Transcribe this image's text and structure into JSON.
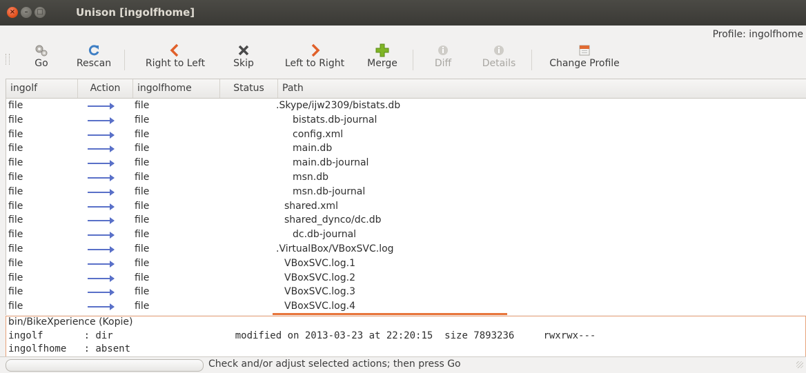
{
  "window": {
    "title": "Unison [ingolfhome]"
  },
  "profile_label": "Profile: ingolfhome",
  "toolbar": {
    "go": "Go",
    "rescan": "Rescan",
    "right_to_left": "Right to Left",
    "skip": "Skip",
    "left_to_right": "Left to Right",
    "merge": "Merge",
    "diff": "Diff",
    "details": "Details",
    "change_profile": "Change Profile"
  },
  "columns": [
    "ingolf",
    "Action",
    "ingolfhome",
    "Status",
    "Path"
  ],
  "rows": [
    {
      "left": "file",
      "right": "file",
      "path": ".Skype/ijw2309/bistats.db",
      "indent": 0
    },
    {
      "left": "file",
      "right": "file",
      "path": "bistats.db-journal",
      "indent": 2
    },
    {
      "left": "file",
      "right": "file",
      "path": "config.xml",
      "indent": 2
    },
    {
      "left": "file",
      "right": "file",
      "path": "main.db",
      "indent": 2
    },
    {
      "left": "file",
      "right": "file",
      "path": "main.db-journal",
      "indent": 2
    },
    {
      "left": "file",
      "right": "file",
      "path": "msn.db",
      "indent": 2
    },
    {
      "left": "file",
      "right": "file",
      "path": "msn.db-journal",
      "indent": 2
    },
    {
      "left": "file",
      "right": "file",
      "path": "shared.xml",
      "indent": 1
    },
    {
      "left": "file",
      "right": "file",
      "path": "shared_dynco/dc.db",
      "indent": 1
    },
    {
      "left": "file",
      "right": "file",
      "path": "dc.db-journal",
      "indent": 2
    },
    {
      "left": "file",
      "right": "file",
      "path": ".VirtualBox/VBoxSVC.log",
      "indent": 0
    },
    {
      "left": "file",
      "right": "file",
      "path": "VBoxSVC.log.1",
      "indent": 1
    },
    {
      "left": "file",
      "right": "file",
      "path": "VBoxSVC.log.2",
      "indent": 1
    },
    {
      "left": "file",
      "right": "file",
      "path": "VBoxSVC.log.3",
      "indent": 1
    },
    {
      "left": "file",
      "right": "file",
      "path": "VBoxSVC.log.4",
      "indent": 1
    }
  ],
  "details": {
    "path": "bin/BikeXperience (Kopie)",
    "line1": "ingolf       : dir                     modified on 2013-03-23 at 22:20:15  size 7893236     rwxrwx---",
    "line2": "ingolfhome   : absent"
  },
  "status": "Check and/or adjust selected actions; then press Go",
  "colors": {
    "arrow": "#5970c8",
    "accent": "#e8753a",
    "close": "#e2531f"
  },
  "icons": {
    "go": "gears-icon",
    "rescan": "refresh-icon",
    "right_to_left": "left-chevron-icon",
    "skip": "x-icon",
    "left_to_right": "right-chevron-icon",
    "merge": "plus-icon",
    "diff": "info-icon",
    "details": "info-icon",
    "change_profile": "folder-icon"
  }
}
